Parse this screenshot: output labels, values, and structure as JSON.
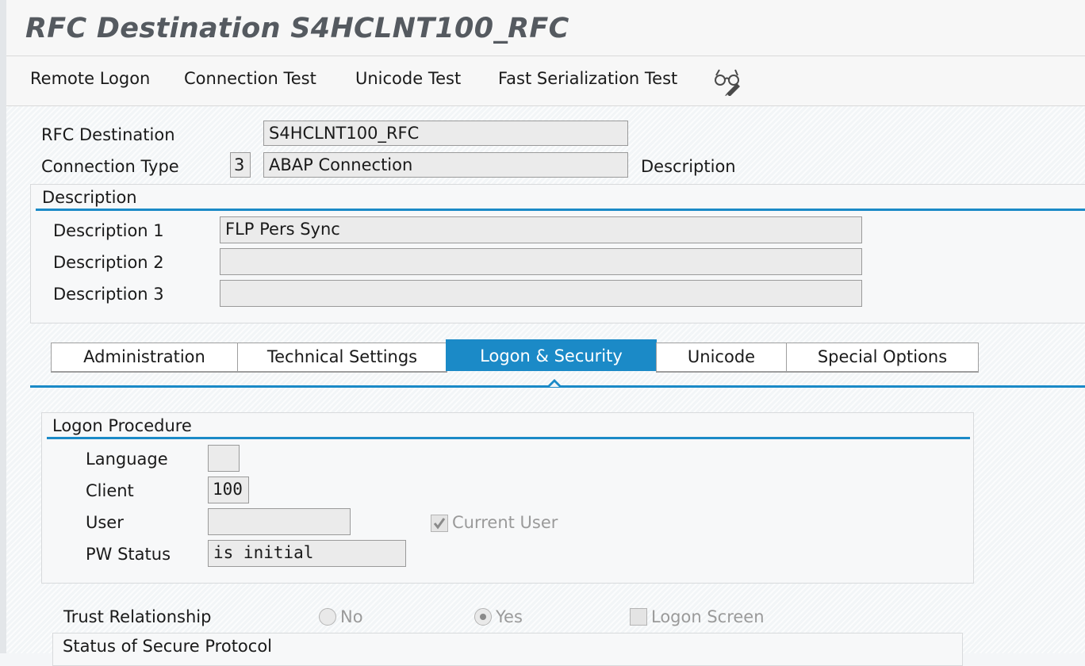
{
  "window": {
    "title": "RFC Destination S4HCLNT100_RFC"
  },
  "toolbar": {
    "remote_logon": "Remote Logon",
    "connection_test": "Connection Test",
    "unicode_test": "Unicode Test",
    "fast_serialization_test": "Fast Serialization Test",
    "display_change_icon": "glasses-pencil-icon"
  },
  "header": {
    "rfc_destination_label": "RFC Destination",
    "rfc_destination_value": "S4HCLNT100_RFC",
    "connection_type_label": "Connection Type",
    "connection_type_code": "3",
    "connection_type_text": "ABAP Connection",
    "description_label": "Description"
  },
  "description_group": {
    "title": "Description",
    "rows": [
      {
        "label": "Description 1",
        "value": "FLP Pers Sync"
      },
      {
        "label": "Description 2",
        "value": ""
      },
      {
        "label": "Description 3",
        "value": ""
      }
    ]
  },
  "tabs": [
    {
      "label": "Administration",
      "active": false
    },
    {
      "label": "Technical Settings",
      "active": false
    },
    {
      "label": "Logon & Security",
      "active": true
    },
    {
      "label": "Unicode",
      "active": false
    },
    {
      "label": "Special Options",
      "active": false
    }
  ],
  "logon_procedure": {
    "title": "Logon Procedure",
    "language_label": "Language",
    "language_value": "",
    "client_label": "Client",
    "client_value": "100",
    "user_label": "User",
    "user_value": "",
    "current_user_label": "Current User",
    "current_user_checked": true,
    "pw_status_label": "PW Status",
    "pw_status_value": "is initial"
  },
  "trust": {
    "label": "Trust Relationship",
    "no_label": "No",
    "yes_label": "Yes",
    "selected": "Yes",
    "logon_screen_label": "Logon Screen",
    "logon_screen_checked": false
  },
  "secure_protocol": {
    "title": "Status of Secure Protocol"
  },
  "colors": {
    "accent": "#1b8ac7",
    "title_text": "#555a60"
  }
}
